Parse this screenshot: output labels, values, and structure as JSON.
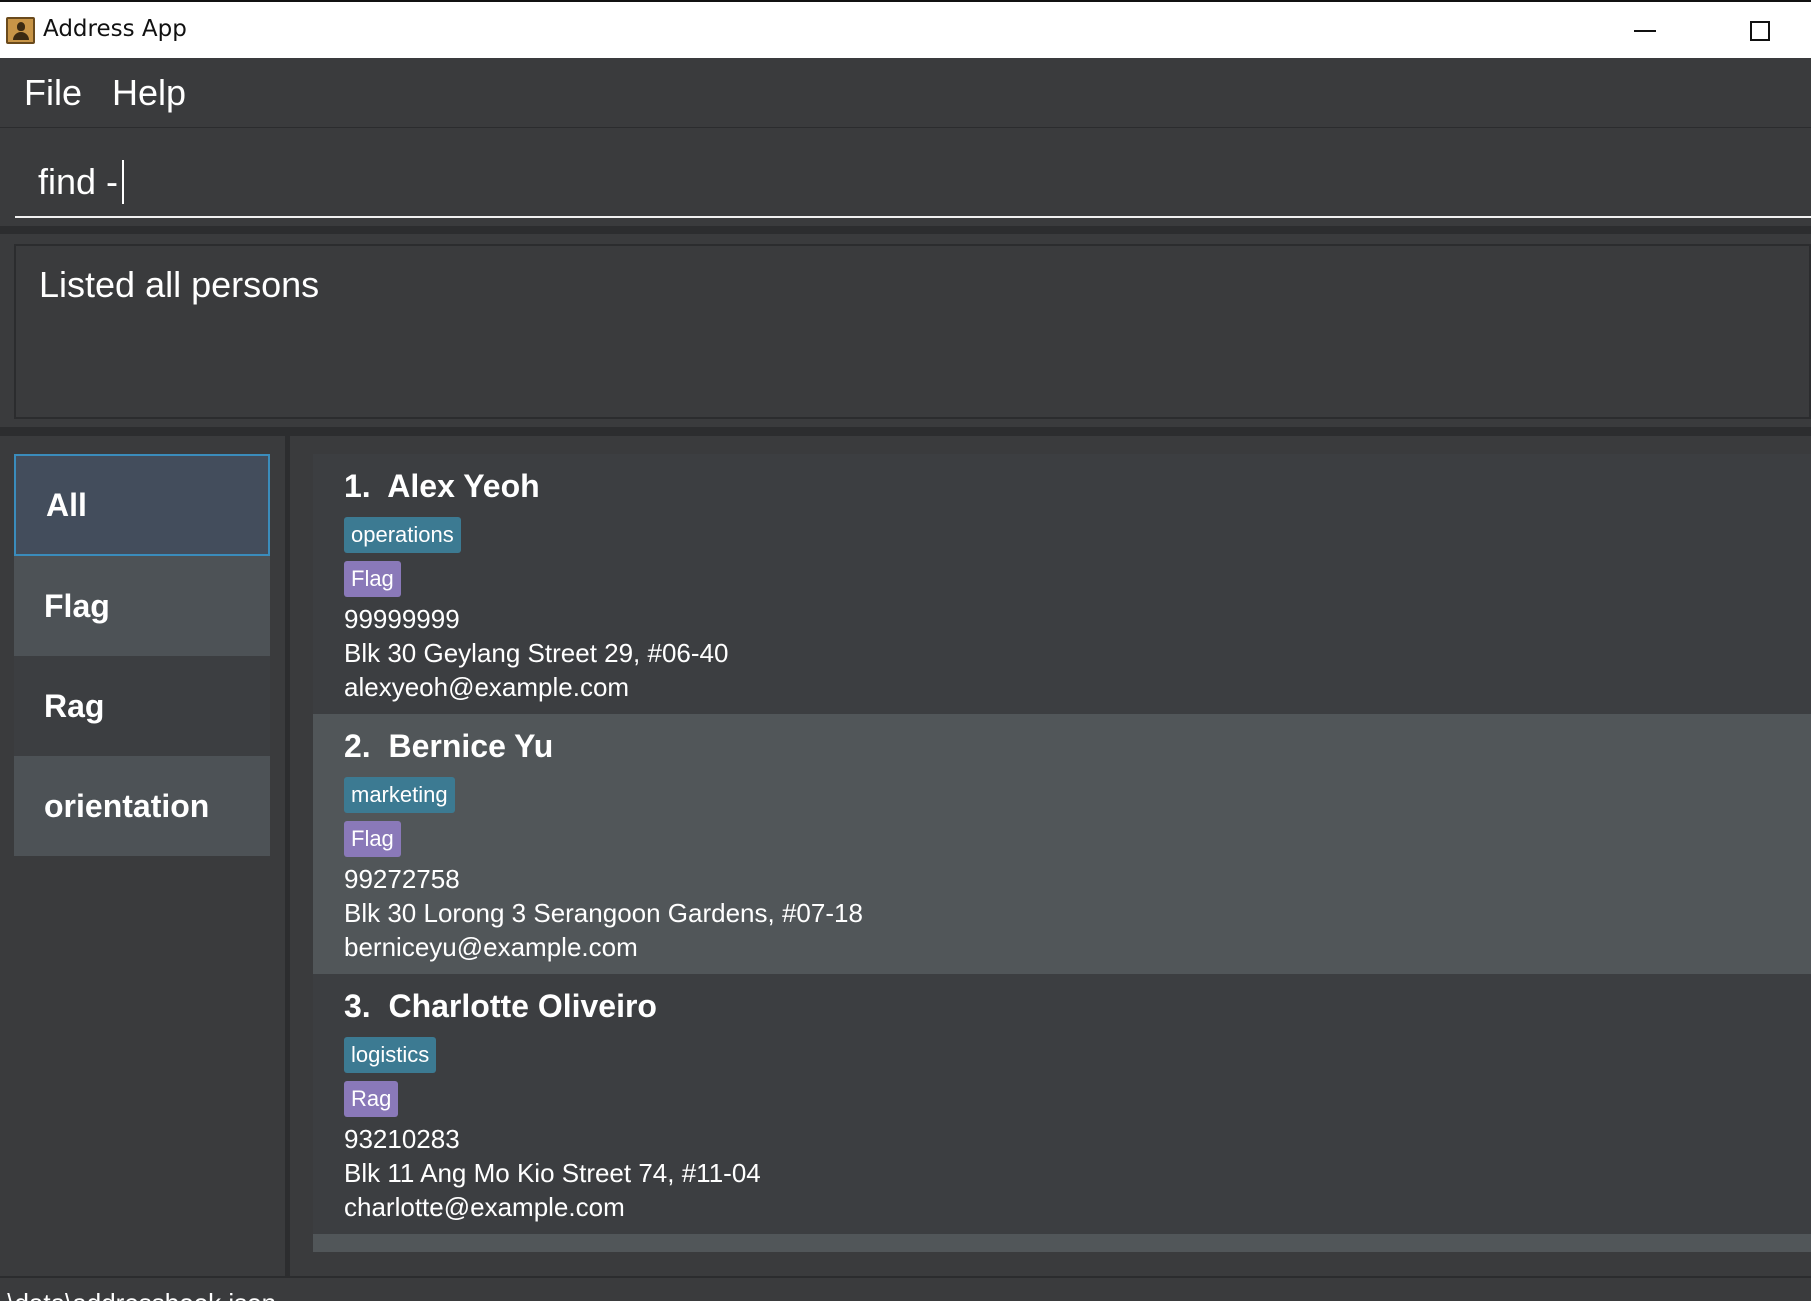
{
  "window": {
    "title": "Address App",
    "minimize_icon": "minimize-icon",
    "maximize_icon": "maximize-icon"
  },
  "menu": {
    "items": [
      {
        "label": "File"
      },
      {
        "label": "Help"
      }
    ]
  },
  "command": {
    "value": "find -"
  },
  "result": {
    "text": "Listed all persons"
  },
  "sidebar": {
    "items": [
      {
        "label": "All",
        "selected": true
      },
      {
        "label": "Flag"
      },
      {
        "label": "Rag"
      },
      {
        "label": "orientation"
      }
    ]
  },
  "persons": [
    {
      "index": "1.",
      "name": "Alex Yeoh",
      "tags": [
        "operations",
        "Flag"
      ],
      "phone": "99999999",
      "address": "Blk 30 Geylang Street 29, #06-40",
      "email": "alexyeoh@example.com"
    },
    {
      "index": "2.",
      "name": "Bernice Yu",
      "tags": [
        "marketing",
        "Flag"
      ],
      "phone": "99272758",
      "address": "Blk 30 Lorong 3 Serangoon Gardens, #07-18",
      "email": "berniceyu@example.com"
    },
    {
      "index": "3.",
      "name": "Charlotte Oliveiro",
      "tags": [
        "logistics",
        "Rag"
      ],
      "phone": "93210283",
      "address": "Blk 11 Ang Mo Kio Street 74, #11-04",
      "email": "charlotte@example.com"
    }
  ],
  "status": {
    "path": ".\\data\\addressbook.json"
  },
  "colors": {
    "background": "#3a3b3d",
    "selected_border": "#3a8cbc",
    "dept_tag": "#3c7a92",
    "flag_tag": "#8a79b9"
  }
}
